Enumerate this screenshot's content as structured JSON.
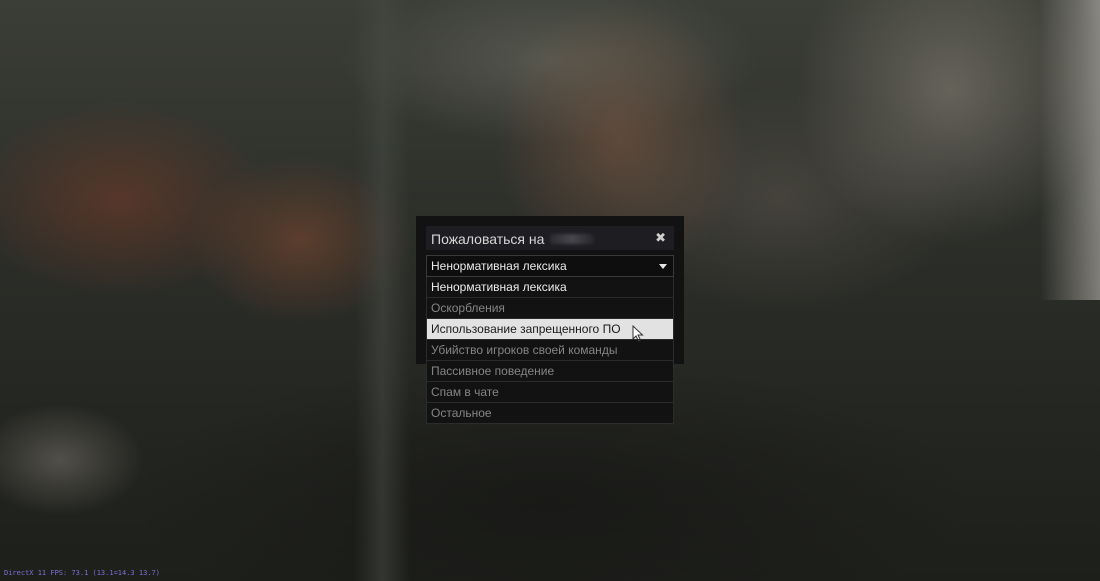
{
  "dialog": {
    "title": "Пожаловаться на",
    "close_icon": "close-icon",
    "select_value": "Ненормативная лексика",
    "options": [
      {
        "label": "Ненормативная лексика",
        "state": "selected"
      },
      {
        "label": "Оскорбления",
        "state": "normal"
      },
      {
        "label": "Использование запрещенного ПО",
        "state": "hovered"
      },
      {
        "label": "Убийство игроков своей команды",
        "state": "normal"
      },
      {
        "label": "Пассивное поведение",
        "state": "normal"
      },
      {
        "label": "Спам в чате",
        "state": "normal"
      },
      {
        "label": "Остальное",
        "state": "normal"
      }
    ]
  },
  "overlay": {
    "fps_text": "DirectX 11 FPS: 73.1 (13.1=14.3 13.7)"
  },
  "colors": {
    "hover_bg": "#e2e2e2",
    "fps_text": "#7a6fd6"
  }
}
